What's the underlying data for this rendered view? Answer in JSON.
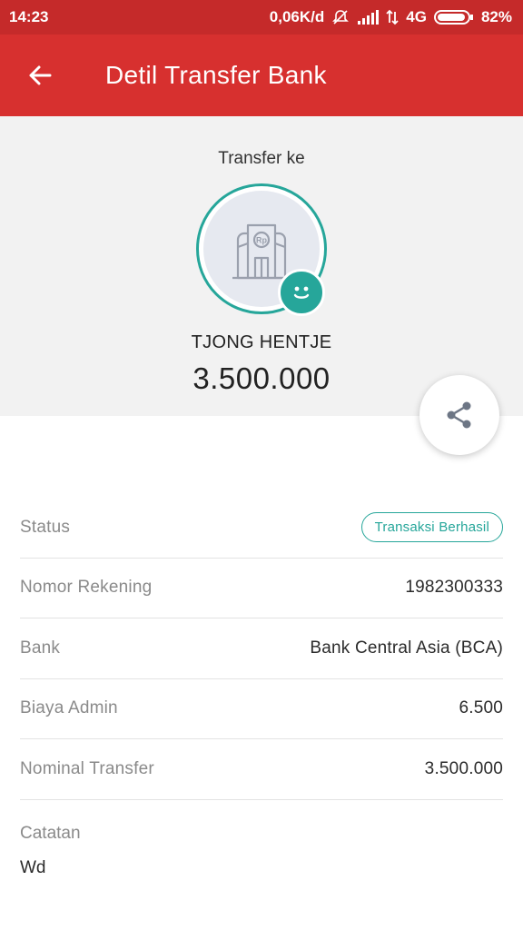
{
  "status_bar": {
    "time": "14:23",
    "net_speed": "0,06K/d",
    "network": "4G",
    "battery": "82%"
  },
  "app_bar": {
    "title": "Detil Transfer Bank",
    "back_icon": "arrow-left-icon"
  },
  "summary": {
    "transfer_to_label": "Transfer ke",
    "recipient_name": "TJONG HENTJE",
    "amount": "3.500.000",
    "bank_icon_badge": "Rp"
  },
  "details": {
    "status_label": "Status",
    "status_value": "Transaksi Berhasil",
    "account_label": "Nomor Rekening",
    "account_value": "1982300333",
    "bank_label": "Bank",
    "bank_value": "Bank Central Asia (BCA)",
    "fee_label": "Biaya Admin",
    "fee_value": "6.500",
    "nominal_label": "Nominal Transfer",
    "nominal_value": "3.500.000",
    "note_label": "Catatan",
    "note_value": "Wd"
  },
  "colors": {
    "primary": "#d7302f",
    "status_bar": "#c52a2a",
    "accent": "#26a69a"
  }
}
